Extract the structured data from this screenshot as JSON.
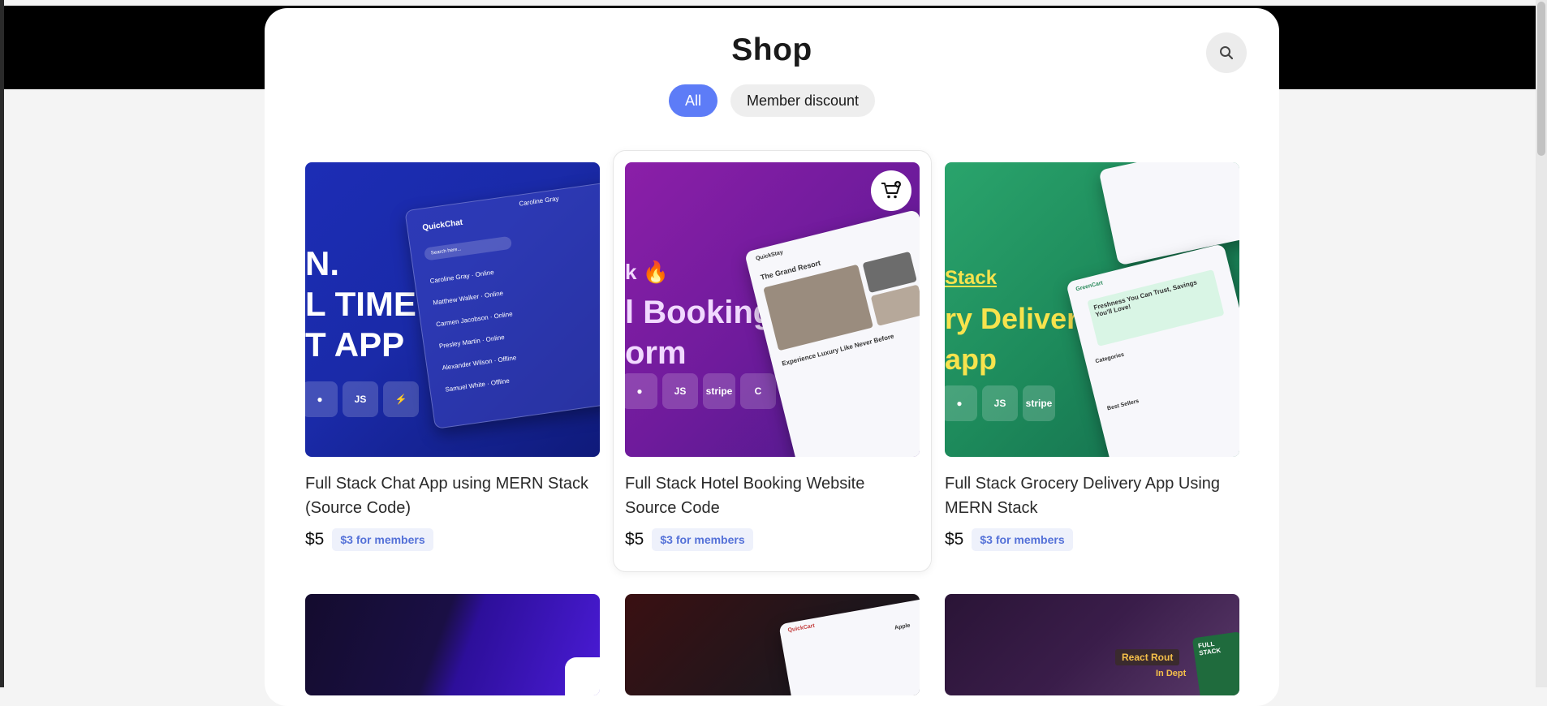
{
  "page": {
    "title": "Shop"
  },
  "header": {
    "search_icon": "search-icon"
  },
  "filters": [
    {
      "label": "All",
      "active": true
    },
    {
      "label": "Member discount",
      "active": false
    }
  ],
  "products": [
    {
      "name": "Full Stack Chat App using MERN Stack (Source Code)",
      "price": "$5",
      "member_price": "$3 for members",
      "thumb": {
        "line1": "N.",
        "line2": "L TIME",
        "line3": "T APP",
        "app_name": "QuickChat",
        "contact": "Caroline Gray",
        "search_placeholder": "Search here...",
        "contacts": [
          {
            "name": "Caroline Gray",
            "status": "Online"
          },
          {
            "name": "Matthew Walker",
            "status": "Online"
          },
          {
            "name": "Carmen Jacobson",
            "status": "Online"
          },
          {
            "name": "Presley Martin",
            "status": "Online"
          },
          {
            "name": "Alexander Wilson",
            "status": "Offline"
          },
          {
            "name": "Samuel White",
            "status": "Offline"
          }
        ],
        "colors": {
          "bg": "#1d2fb8"
        }
      }
    },
    {
      "name": "Full Stack Hotel Booking Website Source Code",
      "price": "$5",
      "member_price": "$3 for members",
      "thumb": {
        "line1": "k 🔥",
        "line2": "l Booking",
        "line3": "orm",
        "mock_title": "The Grand Resort",
        "mock_heading": "Experience Luxury Like Never Before",
        "brand": "QuickStay",
        "stripe": "stripe",
        "colors": {
          "bg": "#7a1fa3"
        }
      }
    },
    {
      "name": "Full Stack Grocery Delivery App Using MERN Stack",
      "price": "$5",
      "member_price": "$3 for members",
      "thumb": {
        "line1": "Stack",
        "line2": "ry Delivery",
        "line3": "app",
        "headline": "Freshness You Can Trust, Savings You'll Love!",
        "section1": "Categories",
        "section2": "Best Sellers",
        "brand": "GreenCart",
        "stripe": "stripe",
        "colors": {
          "bg": "#1f8a5e"
        }
      }
    },
    {
      "name": "",
      "price": "",
      "member_price": "",
      "thumb": {
        "colors": {
          "bg": "#140c2e"
        }
      }
    },
    {
      "name": "",
      "price": "",
      "member_price": "",
      "thumb": {
        "brand": "QuickCart",
        "product": "Apple",
        "colors": {
          "bg": "#2a1115"
        }
      }
    },
    {
      "name": "",
      "price": "",
      "member_price": "",
      "thumb": {
        "tag1": "React Rout",
        "tag2": "In Dept",
        "badge": "FULL STACK",
        "colors": {
          "bg": "#2b1738"
        }
      }
    }
  ],
  "colors": {
    "accent": "#5d7cf7",
    "member_badge_text": "#5471d8",
    "member_badge_bg": "#eef1fb"
  }
}
